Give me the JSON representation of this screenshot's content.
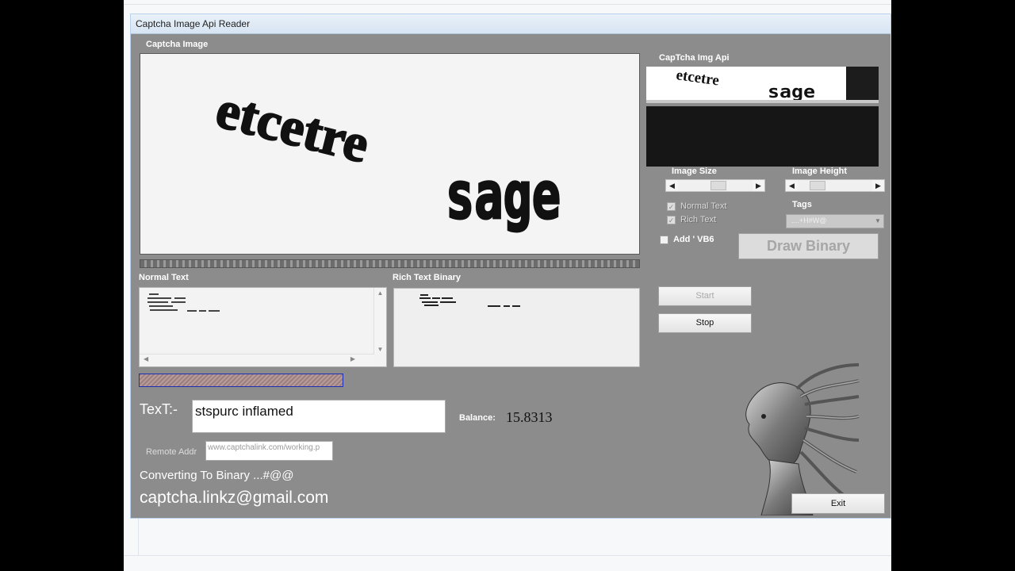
{
  "window": {
    "title": "Captcha Image Api Reader"
  },
  "captcha_image": {
    "label": "Captcha Image",
    "word1": "etcetre",
    "word2": "sage"
  },
  "api_panel": {
    "label": "CapTcha Img Api",
    "word1": "etcetre",
    "word2": "sage"
  },
  "image_size": {
    "label": "Image Size",
    "level": 0.55
  },
  "image_height": {
    "label": "Image Height",
    "level": 0.2
  },
  "normal_text_check": {
    "label": "Normal Text",
    "checked": true,
    "glyph": "✓"
  },
  "rich_text_check": {
    "label": "Rich Text",
    "checked": true,
    "glyph": "✓"
  },
  "tags": {
    "label": "Tags",
    "value": "....+H#W@"
  },
  "add_vb6": {
    "label": "Add ' VB6",
    "checked": false
  },
  "buttons": {
    "draw_binary": "Draw Binary",
    "start": "Start",
    "stop": "Stop",
    "exit": "Exit"
  },
  "normal_text": {
    "label": "Normal Text"
  },
  "rich_text_binary": {
    "label": "Rich Text Binary"
  },
  "result": {
    "label": "TexT:-",
    "value": "stspurc inflamed"
  },
  "balance": {
    "label": "Balance:",
    "value": "15.8313"
  },
  "remote": {
    "label": "Remote Addr",
    "value": "www.captchalink.com/working.p"
  },
  "status": {
    "text": "Converting To Binary ...#@@"
  },
  "email": {
    "text": "captcha.linkz@gmail.com"
  },
  "colors": {
    "window_bg": "#8c8c8c",
    "title_bg": "#dce8f5",
    "stripe_border": "#1e2fb4"
  }
}
